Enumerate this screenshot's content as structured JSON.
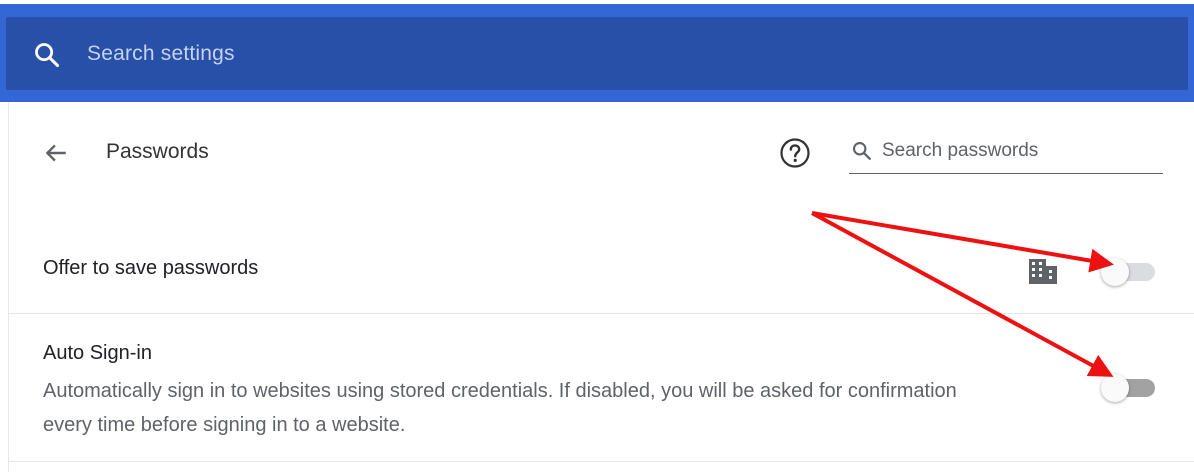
{
  "search": {
    "placeholder": "Search settings",
    "icon": "search-icon"
  },
  "page": {
    "title": "Passwords",
    "back_icon": "back-arrow-icon",
    "help_icon": "help-icon",
    "search_passwords_placeholder": "Search passwords"
  },
  "settings": {
    "offer_save": {
      "label": "Offer to save passwords",
      "enterprise_icon": "building-icon",
      "enabled": false
    },
    "auto_signin": {
      "label": "Auto Sign-in",
      "description": "Automatically sign in to websites using stored credentials. If disabled, you will be asked for confirmation every time before signing in to a website.",
      "enabled": false
    }
  },
  "colors": {
    "header_bg": "#3367d6",
    "search_bar_bg": "#2850a8",
    "annotation_red": "#ee1111"
  }
}
